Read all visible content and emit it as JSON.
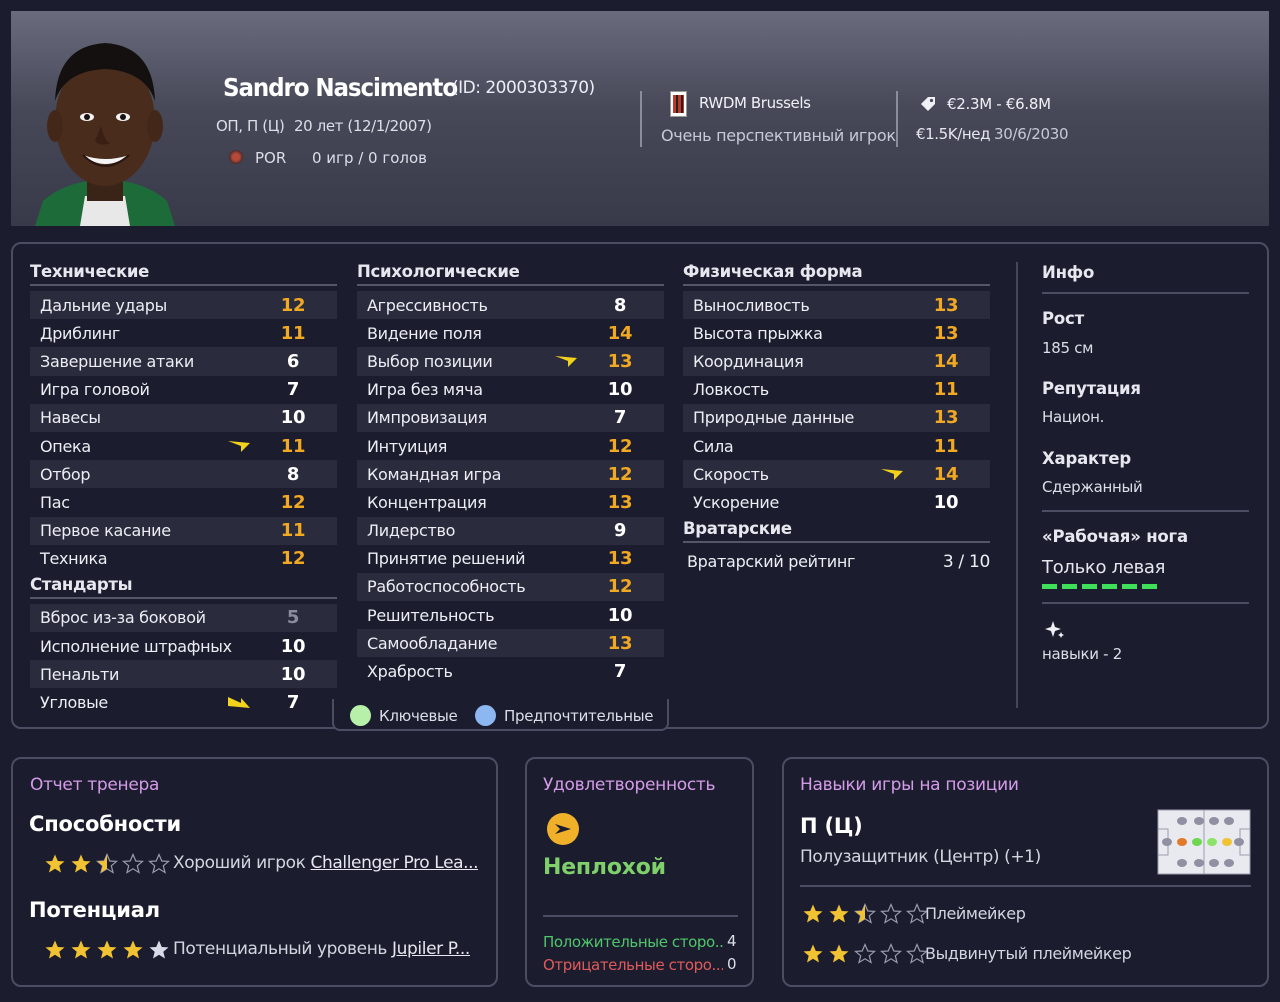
{
  "player": {
    "name": "Sandro Nascimento",
    "id": "(ID: 2000303370)",
    "position": "ОП, П (Ц)",
    "age": "20 лет (12/1/2007)",
    "nation": "POR",
    "apps": "0 игр / 0 голов",
    "club": "RWDM Brussels",
    "prospect": "Очень перспективный игрок",
    "value": "€2.3M - €6.8M",
    "wage": "€1.5K/нед",
    "contract": "30/6/2030"
  },
  "technical": {
    "title": "Технические",
    "rows": [
      {
        "name": "Дальние удары",
        "value": "12"
      },
      {
        "name": "Дриблинг",
        "value": "11"
      },
      {
        "name": "Завершение атаки",
        "value": "6"
      },
      {
        "name": "Игра головой",
        "value": "7"
      },
      {
        "name": "Навесы",
        "value": "10"
      },
      {
        "name": "Опека",
        "value": "11"
      },
      {
        "name": "Отбор",
        "value": "8"
      },
      {
        "name": "Пас",
        "value": "12"
      },
      {
        "name": "Первое касание",
        "value": "11"
      },
      {
        "name": "Техника",
        "value": "12"
      }
    ]
  },
  "setpieces": {
    "title": "Стандарты",
    "rows": [
      {
        "name": "Вброс из-за боковой",
        "value": "5"
      },
      {
        "name": "Исполнение штрафных",
        "value": "10"
      },
      {
        "name": "Пенальти",
        "value": "10"
      },
      {
        "name": "Угловые",
        "value": "7"
      }
    ]
  },
  "mental": {
    "title": "Психологические",
    "rows": [
      {
        "name": "Агрессивность",
        "value": "8"
      },
      {
        "name": "Видение поля",
        "value": "14"
      },
      {
        "name": "Выбор позиции",
        "value": "13"
      },
      {
        "name": "Игра без мяча",
        "value": "10"
      },
      {
        "name": "Импровизация",
        "value": "7"
      },
      {
        "name": "Интуиция",
        "value": "12"
      },
      {
        "name": "Командная игра",
        "value": "12"
      },
      {
        "name": "Концентрация",
        "value": "13"
      },
      {
        "name": "Лидерство",
        "value": "9"
      },
      {
        "name": "Принятие решений",
        "value": "13"
      },
      {
        "name": "Работоспособность",
        "value": "12"
      },
      {
        "name": "Решительность",
        "value": "10"
      },
      {
        "name": "Самообладание",
        "value": "13"
      },
      {
        "name": "Храбрость",
        "value": "7"
      }
    ]
  },
  "physical": {
    "title": "Физическая форма",
    "rows": [
      {
        "name": "Выносливость",
        "value": "13"
      },
      {
        "name": "Высота прыжка",
        "value": "13"
      },
      {
        "name": "Координация",
        "value": "14"
      },
      {
        "name": "Ловкость",
        "value": "11"
      },
      {
        "name": "Природные данные",
        "value": "13"
      },
      {
        "name": "Сила",
        "value": "11"
      },
      {
        "name": "Скорость",
        "value": "14"
      },
      {
        "name": "Ускорение",
        "value": "10"
      }
    ]
  },
  "goalkeeping": {
    "title": "Вратарские",
    "rating_label": "Вратарский рейтинг",
    "rating_value": "3 / 10"
  },
  "legend": {
    "key": "Ключевые",
    "preferred": "Предпочтительные"
  },
  "info": {
    "title": "Инфо",
    "height_label": "Рост",
    "height": "185 см",
    "reputation_label": "Репутация",
    "reputation": "Национ.",
    "character_label": "Характер",
    "character": "Сдержанный",
    "foot_label": "«Рабочая» нога",
    "foot": "Только левая",
    "skills": "навыки - 2"
  },
  "coach_report": {
    "title": "Отчет тренера",
    "ability_label": "Способности",
    "ability_stars": 2.5,
    "ability_text": "Хороший игрок ",
    "ability_link": "Challenger Pro Lea...",
    "potential_label": "Потенциал",
    "potential_stars": 4.5,
    "potential_text": "Потенциальный уровень ",
    "potential_link": "Jupiler P..."
  },
  "happiness": {
    "title": "Удовлетворенность",
    "status": "Неплохой",
    "positives_label": "Положительные сторо...",
    "positives_count": "4",
    "negatives_label": "Отрицательные сторо...",
    "negatives_count": "0"
  },
  "position_skills": {
    "title": "Навыки игры на позиции",
    "position": "П (Ц)",
    "position_full": "Полузащитник (Центр) (+1)",
    "roles": [
      {
        "name": "Плеймейкер",
        "stars": 2.5
      },
      {
        "name": "Выдвинутый плеймейкер",
        "stars": 2
      }
    ]
  },
  "colors": {
    "orange": "#f1a823",
    "white": "#ffffff",
    "grey": "#8a8c9c",
    "accent_pink": "#d59be8",
    "green": "#7fd06a",
    "red": "#e05a5a",
    "star": "#f1c232"
  }
}
